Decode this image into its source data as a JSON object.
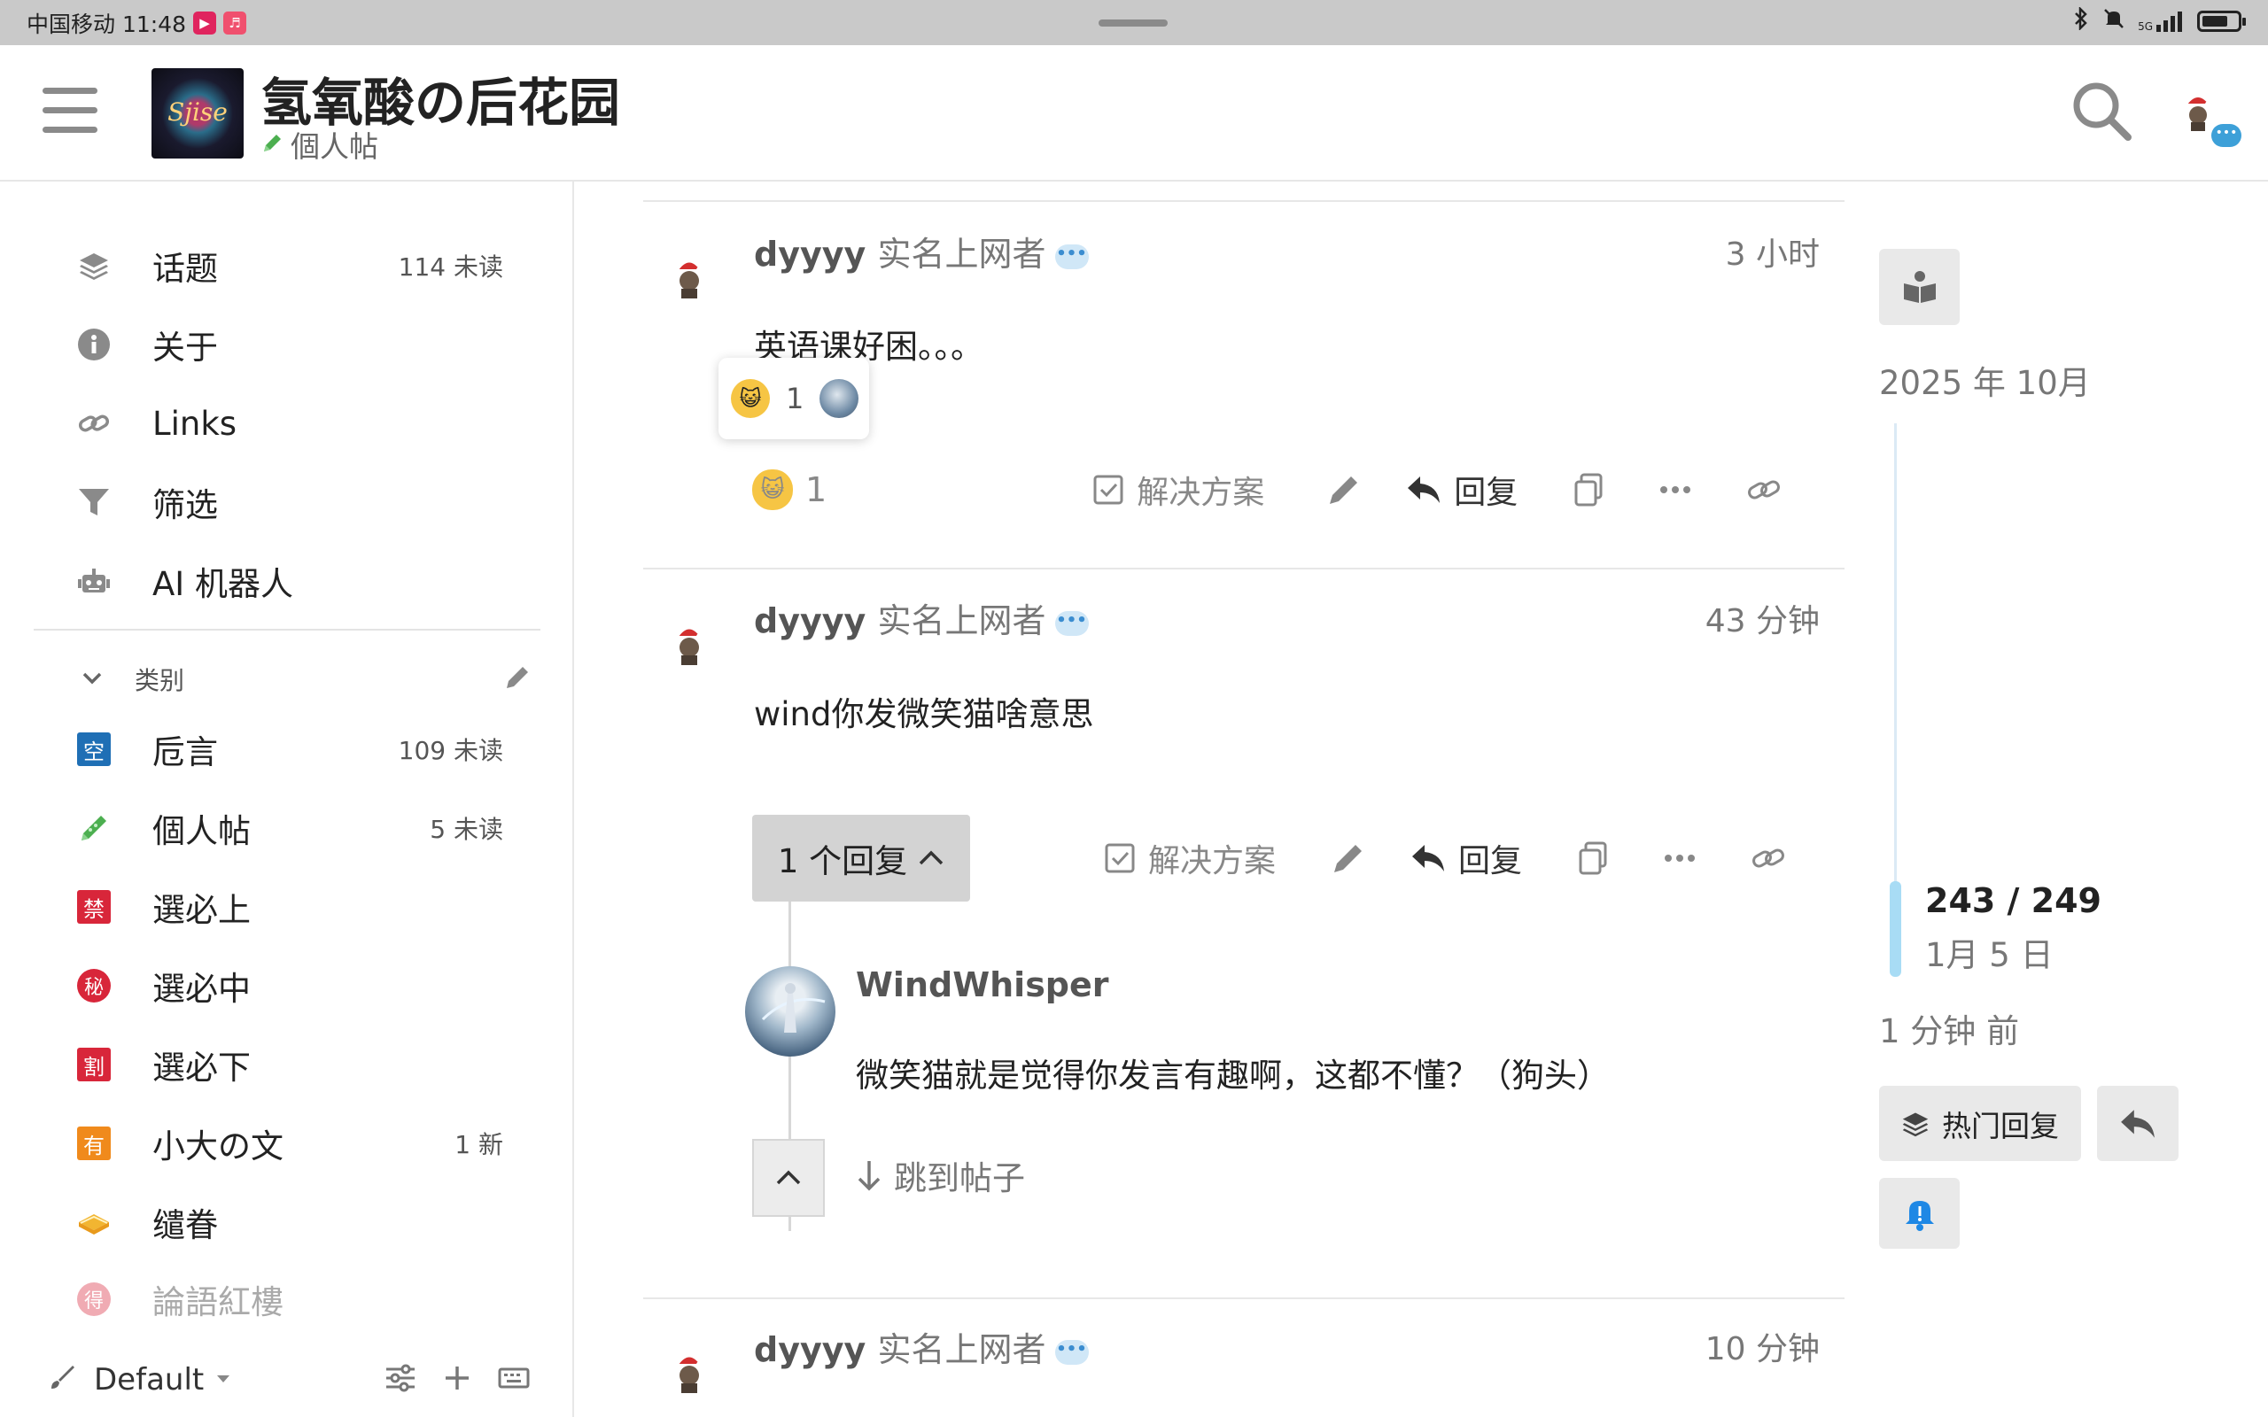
{
  "status_bar": {
    "carrier_time": "中国移动 11:48",
    "app1": "▶",
    "app2": "♬",
    "icons": [
      "bluetooth-icon",
      "mute-icon",
      "signal-icon",
      "battery-icon"
    ],
    "network": "5G"
  },
  "header": {
    "logo_text": "Sjise",
    "site_title": "氢氧酸の后花园",
    "category_label": "個人帖"
  },
  "sidebar": {
    "nav": [
      {
        "label": "话题",
        "count": "114 未读",
        "icon": "layers-icon"
      },
      {
        "label": "关于",
        "count": "",
        "icon": "info-icon"
      },
      {
        "label": "Links",
        "count": "",
        "icon": "link-icon"
      },
      {
        "label": "筛选",
        "count": "",
        "icon": "filter-icon"
      },
      {
        "label": "AI 机器人",
        "count": "",
        "icon": "robot-icon"
      }
    ],
    "categories_title": "类别",
    "categories": [
      {
        "label": "卮言",
        "badge": "空",
        "color": "#1f6fb5",
        "count": "109 未读"
      },
      {
        "label": "個人帖",
        "badge": "",
        "color": "#4caf50",
        "count": "5 未读"
      },
      {
        "label": "選必上",
        "badge": "禁",
        "color": "#d8263a",
        "count": ""
      },
      {
        "label": "選必中",
        "badge": "秘",
        "color": "#d8263a",
        "count": ""
      },
      {
        "label": "選必下",
        "badge": "割",
        "color": "#d8263a",
        "count": ""
      },
      {
        "label": "小大の文",
        "badge": "有",
        "color": "#f08a1c",
        "count": "1 新"
      },
      {
        "label": "缱眷",
        "badge": "",
        "color": "#f2b531",
        "count": ""
      },
      {
        "label": "論語紅樓",
        "badge": "得",
        "color": "#d8263a",
        "count": ""
      }
    ],
    "footer": {
      "theme": "Default"
    }
  },
  "posts": [
    {
      "username": "dyyyy",
      "user_title": "实名上网者",
      "time": "3 小时",
      "text": "英语课好困。。。",
      "reaction_popup_count": "1",
      "reaction_count": "1",
      "actions": {
        "solution": "解决方案",
        "reply": "回复"
      }
    },
    {
      "username": "dyyyy",
      "user_title": "实名上网者",
      "time": "43 分钟",
      "text": "wind你发微笑猫啥意思",
      "replies_label": "1 个回复",
      "actions": {
        "solution": "解决方案",
        "reply": "回复"
      },
      "nested_reply": {
        "username": "WindWhisper",
        "text": "微笑猫就是觉得你发言有趣啊，这都不懂？（狗头）",
        "jump_label": "跳到帖子"
      }
    },
    {
      "username": "dyyyy",
      "user_title": "实名上网者",
      "time": "10 分钟"
    }
  ],
  "timeline": {
    "start_date": "2025 年 10月",
    "position": "243 / 249",
    "position_date": "1月 5 日",
    "last_activity": "1 分钟 前",
    "progress": 0.976,
    "hot_label": "热门回复"
  }
}
